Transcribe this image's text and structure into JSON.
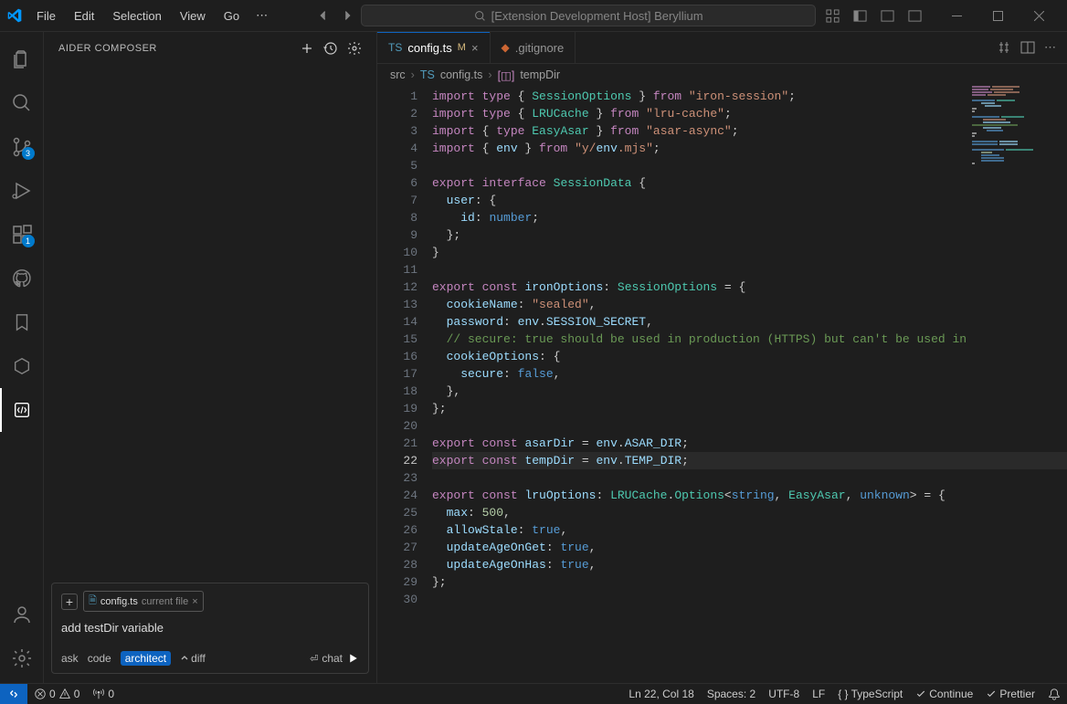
{
  "titlebar": {
    "menus": [
      "File",
      "Edit",
      "Selection",
      "View",
      "Go"
    ],
    "searchText": "[Extension Development Host] Beryllium"
  },
  "activity": {
    "scmBadge": "3",
    "extBadge": "1"
  },
  "sidebar": {
    "title": "AIDER COMPOSER",
    "chip": {
      "file": "config.ts",
      "sub": "current file"
    },
    "chatInput": "add testDir variable",
    "modes": {
      "ask": "ask",
      "code": "code",
      "architect": "architect",
      "diff": "diff"
    },
    "send": "chat"
  },
  "tabs": [
    {
      "name": "config.ts",
      "modified": "M",
      "active": true
    },
    {
      "name": ".gitignore",
      "active": false
    }
  ],
  "breadcrumb": {
    "folder": "src",
    "file": "config.ts",
    "symbol": "tempDir"
  },
  "code": {
    "lines": [
      "import type { SessionOptions } from \"iron-session\";",
      "import type { LRUCache } from \"lru-cache\";",
      "import { type EasyAsar } from \"asar-async\";",
      "import { env } from \"y/env.mjs\";",
      "",
      "export interface SessionData {",
      "  user: {",
      "    id: number;",
      "  };",
      "}",
      "",
      "export const ironOptions: SessionOptions = {",
      "  cookieName: \"sealed\",",
      "  password: env.SESSION_SECRET,",
      "  // secure: true should be used in production (HTTPS) but can't be used in",
      "  cookieOptions: {",
      "    secure: false,",
      "  },",
      "};",
      "",
      "export const asarDir = env.ASAR_DIR;",
      "export const tempDir = env.TEMP_DIR;",
      "",
      "export const lruOptions: LRUCache.Options<string, EasyAsar, unknown> = {",
      "  max: 500,",
      "  allowStale: true,",
      "  updateAgeOnGet: true,",
      "  updateAgeOnHas: true,",
      "};"
    ],
    "currentLine": 22
  },
  "statusbar": {
    "errors": "0",
    "warnings": "0",
    "ports": "0",
    "cursor": "Ln 22, Col 18",
    "spaces": "Spaces: 2",
    "encoding": "UTF-8",
    "eol": "LF",
    "lang": "TypeScript",
    "continue": "Continue",
    "prettier": "Prettier"
  }
}
